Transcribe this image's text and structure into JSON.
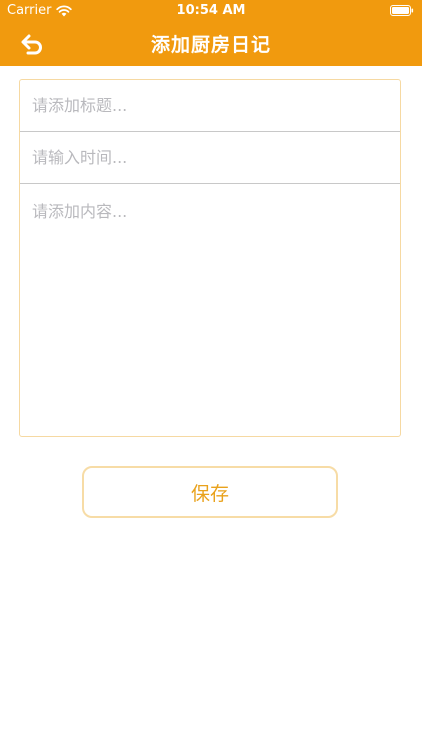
{
  "status_bar": {
    "carrier": "Carrier",
    "time": "10:54 AM",
    "wifi_icon": "wifi-icon",
    "battery_icon": "battery-icon"
  },
  "nav": {
    "title": "添加厨房日记",
    "back_icon": "back-arrow-icon"
  },
  "form": {
    "title_placeholder": "请添加标题...",
    "time_placeholder": "请输入时间...",
    "content_placeholder": "请添加内容..."
  },
  "save_button": {
    "label": "保存"
  },
  "colors": {
    "header_background": "#f19a0e",
    "button_text": "#e9a21c",
    "card_border": "#f6d9a2"
  }
}
